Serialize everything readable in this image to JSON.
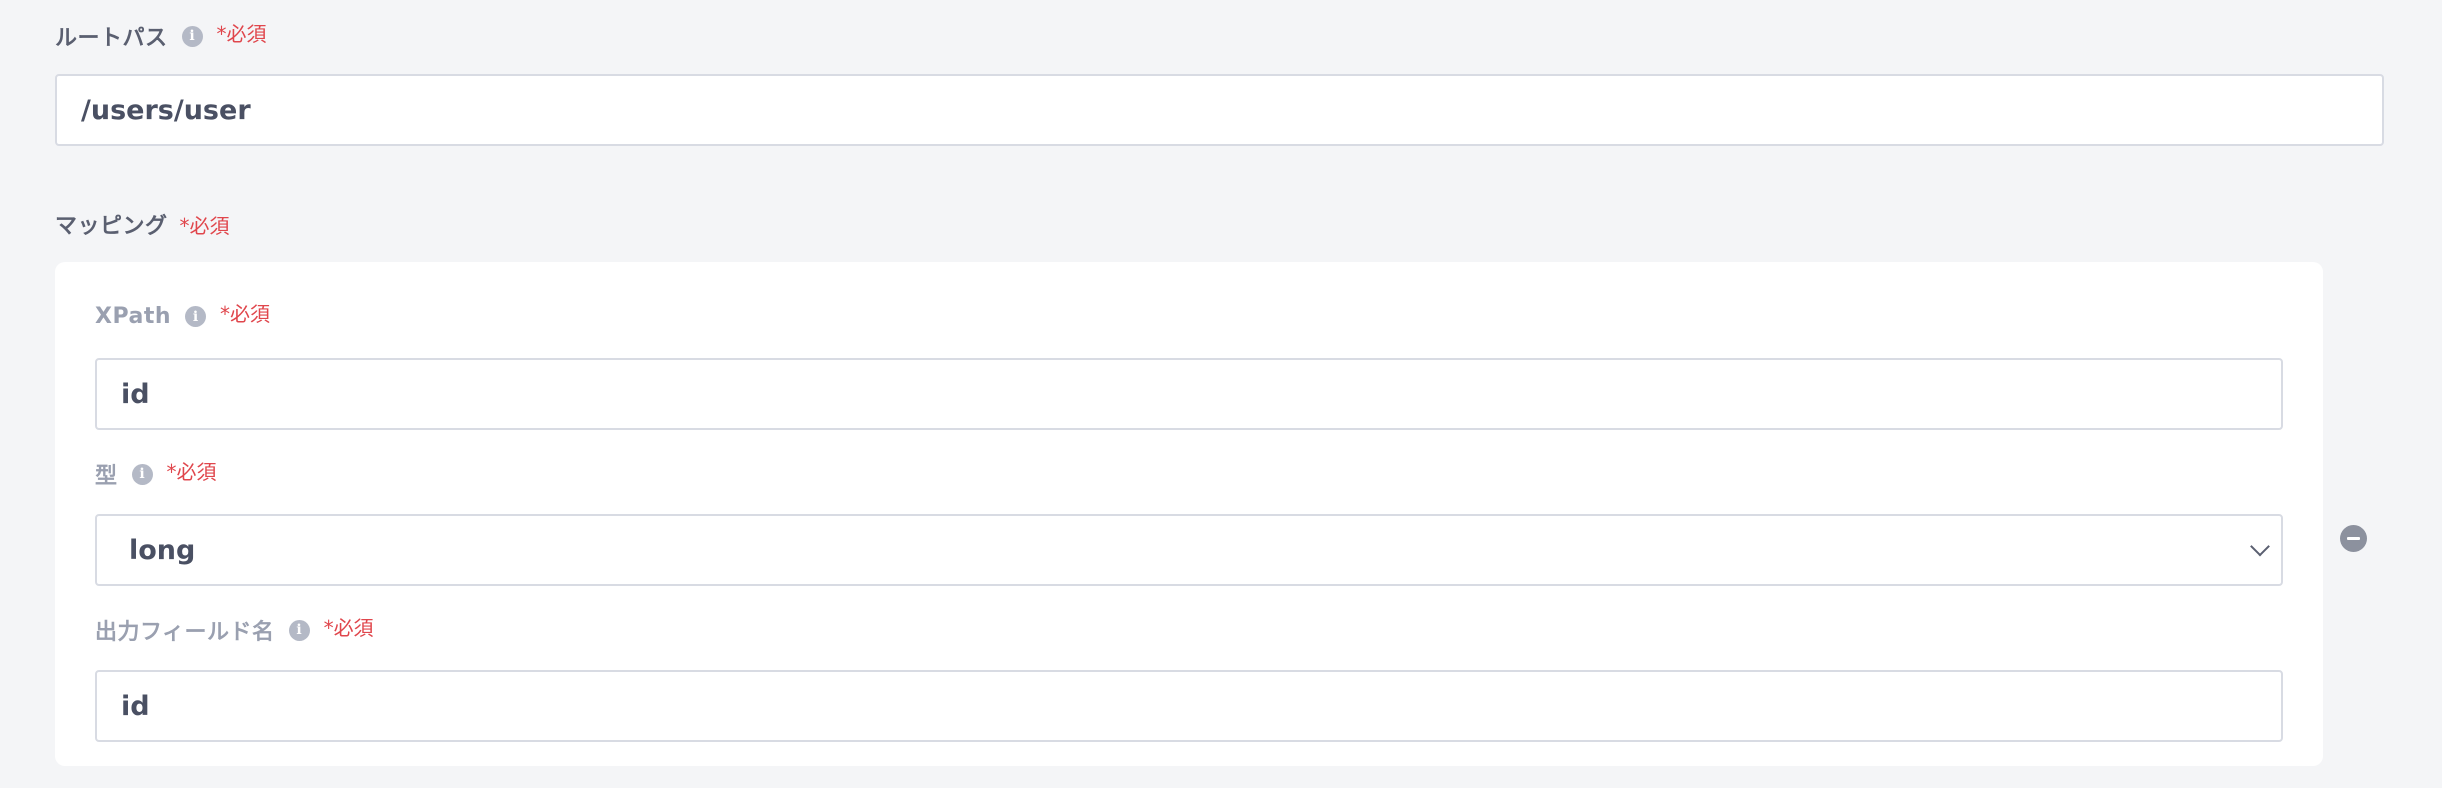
{
  "root_path": {
    "label": "ルートパス",
    "required": "*必須",
    "value": "/users/user"
  },
  "mapping": {
    "label": "マッピング",
    "required": "*必須",
    "xpath": {
      "label": "XPath",
      "required": "*必須",
      "value": "id"
    },
    "type": {
      "label": "型",
      "required": "*必須",
      "selected": "long"
    },
    "output_field": {
      "label": "出力フィールド名",
      "required": "*必須",
      "value": "id"
    }
  }
}
